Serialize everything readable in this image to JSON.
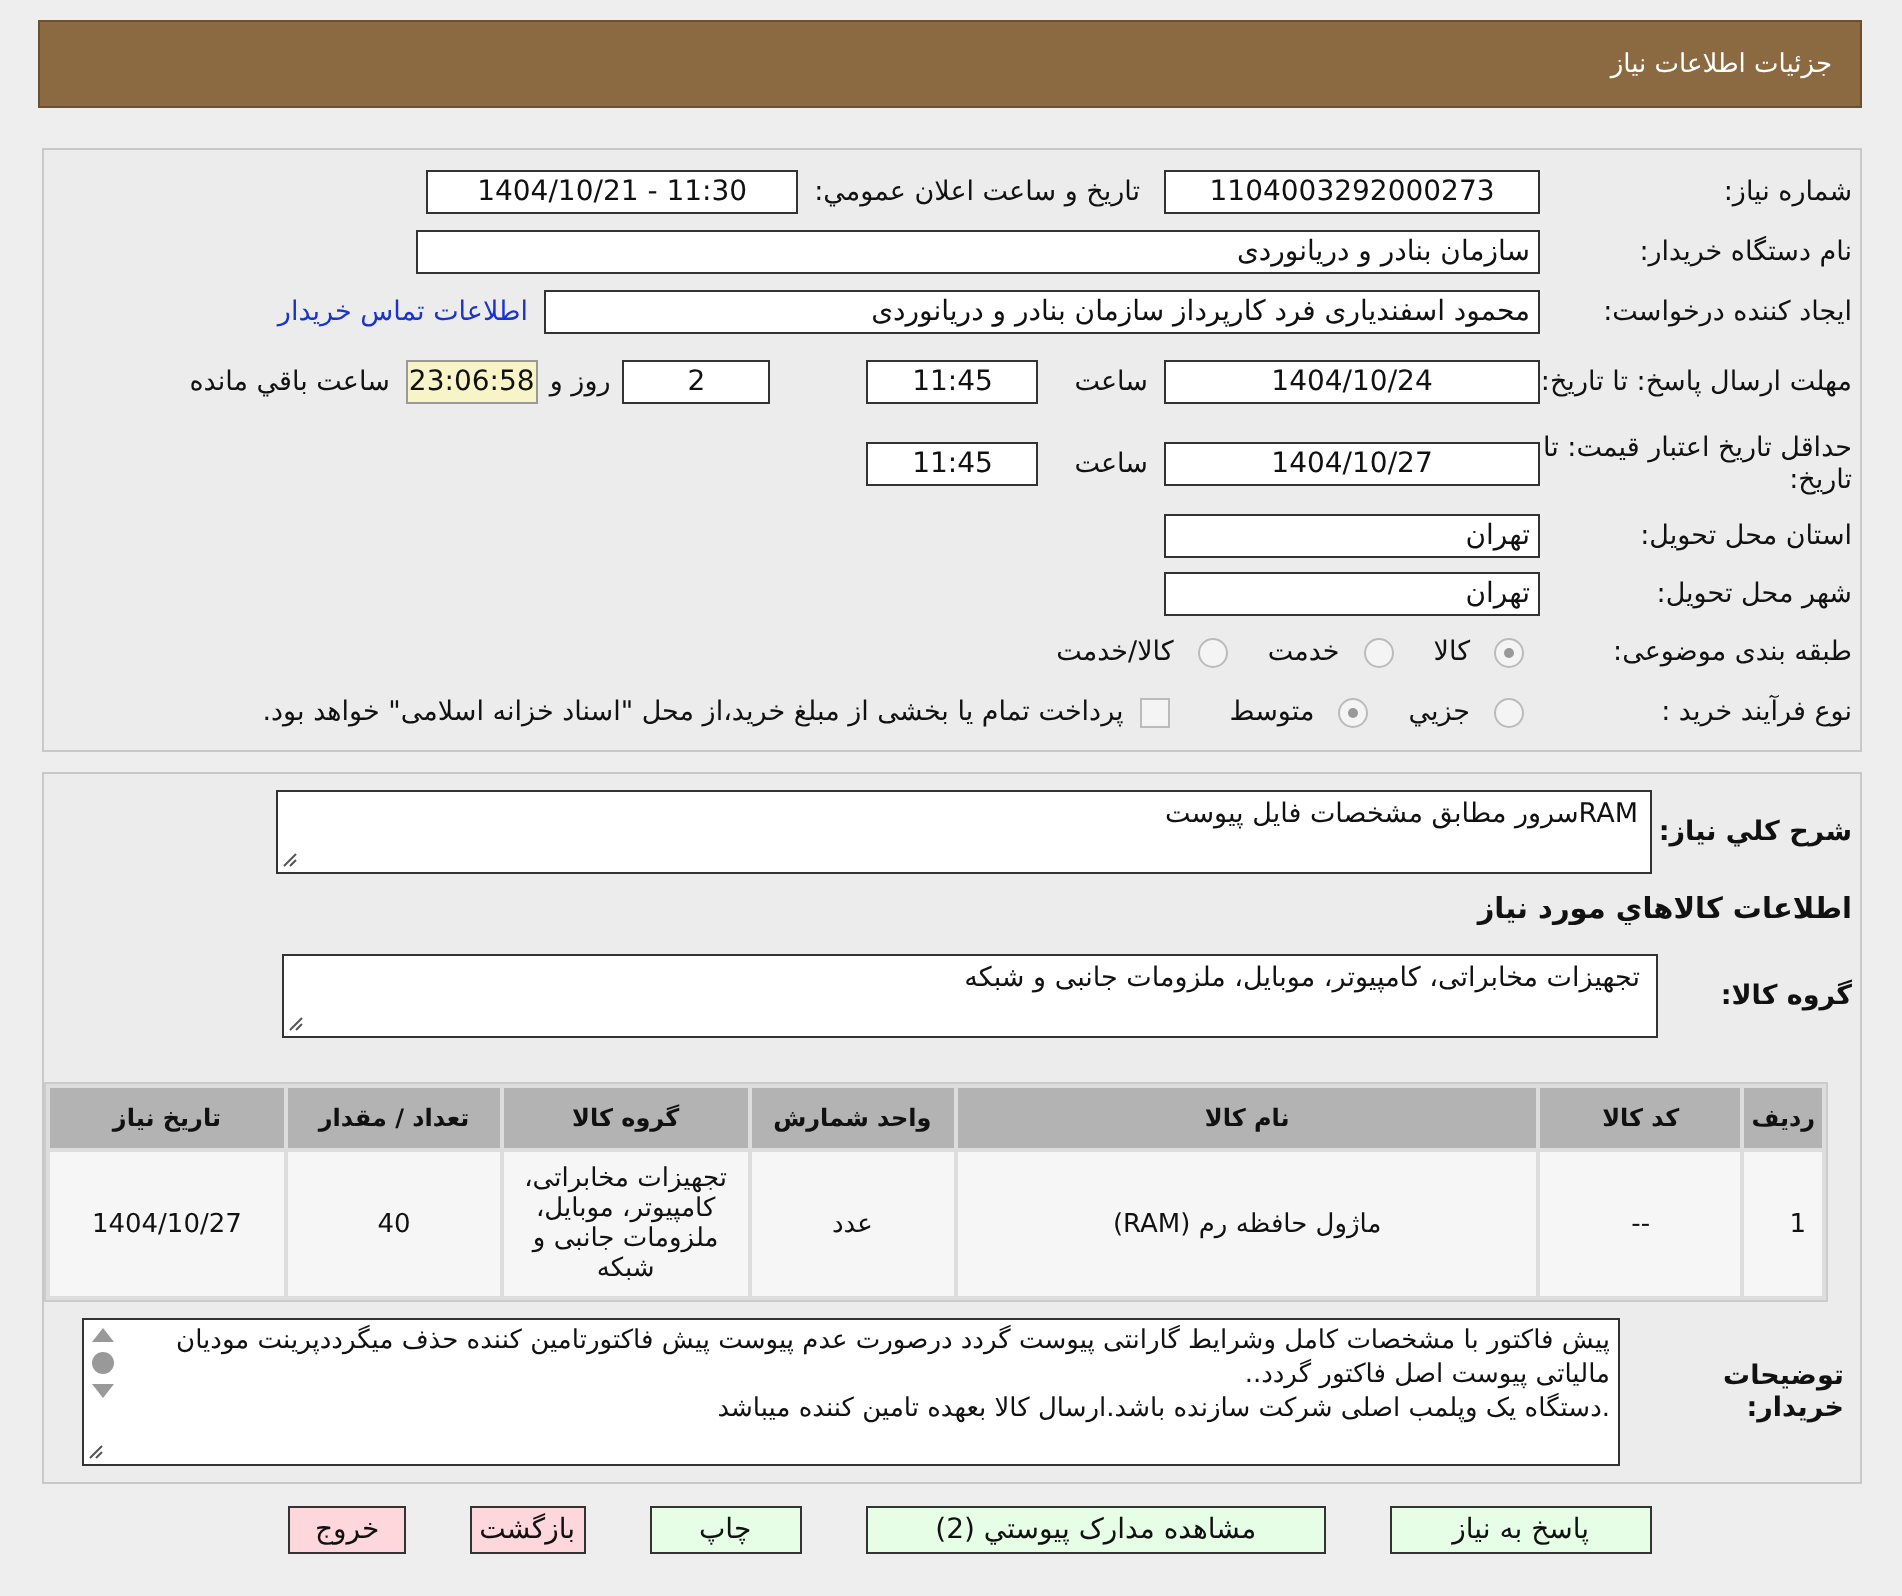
{
  "header": {
    "title": "جزئیات اطلاعات نیاز"
  },
  "need_number": {
    "label": "شماره نیاز:",
    "value": "1104003292000273"
  },
  "announce": {
    "label": "تاریخ و ساعت اعلان عمومي:",
    "value": "1404/10/21 - 11:30"
  },
  "buyer_org": {
    "label": "نام دستگاه خریدار:",
    "value": "سازمان بنادر و دریانوردی"
  },
  "requester": {
    "label": "ایجاد کننده درخواست:",
    "value": "محمود اسفندیاری فرد کارپرداز سازمان بنادر و دریانوردی",
    "link": "اطلاعات تماس خریدار"
  },
  "response_deadline": {
    "label": "مهلت ارسال پاسخ: تا تاریخ:",
    "date": "1404/10/24",
    "time_label": "ساعت",
    "time": "11:45",
    "days": "2",
    "days_label": "روز و",
    "remaining": "23:06:58",
    "remaining_label": "ساعت باقي مانده"
  },
  "price_validity": {
    "label": "حداقل تاریخ اعتبار قیمت: تا تاریخ:",
    "date": "1404/10/27",
    "time_label": "ساعت",
    "time": "11:45"
  },
  "province": {
    "label": "استان محل تحویل:",
    "value": "تهران"
  },
  "city": {
    "label": "شهر محل تحویل:",
    "value": "تهران"
  },
  "category": {
    "label": "طبقه بندی موضوعی:",
    "options": [
      {
        "label": "کالا",
        "selected": true
      },
      {
        "label": "خدمت",
        "selected": false
      },
      {
        "label": "کالا/خدمت",
        "selected": false
      }
    ]
  },
  "process": {
    "label": "نوع فرآیند خرید :",
    "options": [
      {
        "label": "جزيي",
        "selected": false
      },
      {
        "label": "متوسط",
        "selected": true
      }
    ],
    "payment": {
      "checked": false,
      "text": "پرداخت تمام یا بخشی از مبلغ خرید،از محل \"اسناد خزانه اسلامی\" خواهد بود."
    }
  },
  "description": {
    "label": "شرح كلي نياز:",
    "value": "RAMسرور مطابق مشخصات فایل پیوست"
  },
  "goods_heading": "اطلاعات كالاهاي مورد نياز",
  "goods_group": {
    "label": "گروه کالا:",
    "value": "تجهیزات مخابراتی، کامپیوتر، موبایل، ملزومات جانبی و شبکه"
  },
  "table": {
    "columns": [
      "ردیف",
      "کد کالا",
      "نام کالا",
      "واحد شمارش",
      "گروه کالا",
      "تعداد / مقدار",
      "تاریخ نیاز"
    ],
    "rows": [
      [
        "1",
        "--",
        "ماژول حافظه رم (RAM)",
        "عدد",
        "تجهیزات مخابراتی، کامپیوتر، موبایل، ملزومات جانبی و شبکه",
        "40",
        "1404/10/27"
      ]
    ]
  },
  "buyer_notes": {
    "label": "توضیحات خریدار:",
    "lines": [
      "پیش فاکتور با مشخصات کامل وشرایط گارانتی پیوست گردد درصورت عدم پیوست پیش فاکتورتامین کننده حذف میگرددپرینت مودیان مالیاتی پیوست اصل فاکتور گردد..",
      ".دستگاه یک وپلمب اصلی شرکت سازنده باشد.ارسال کالا بعهده تامین کننده میباشد"
    ]
  },
  "buttons": [
    {
      "label": "پاسخ به نیاز",
      "kind": "action"
    },
    {
      "label": "مشاهده مدارک پیوستي (2)",
      "kind": "action"
    },
    {
      "label": "چاپ",
      "kind": "action"
    },
    {
      "label": "بازگشت",
      "kind": "exit"
    },
    {
      "label": "خروج",
      "kind": "exit"
    }
  ]
}
